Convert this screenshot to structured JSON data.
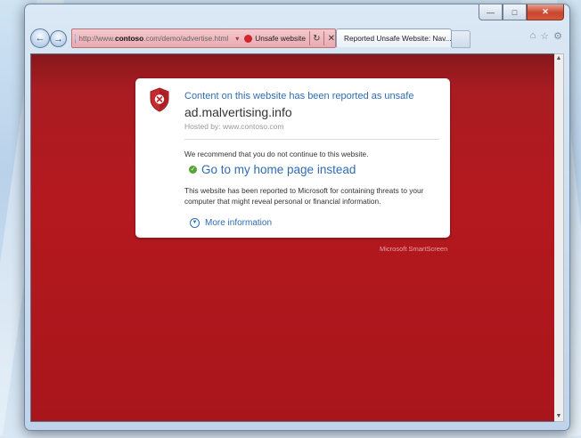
{
  "browser": {
    "address": {
      "url_prefix": "http://www.",
      "url_host": "contoso",
      "url_suffix": ".com/demo/advertise.html",
      "warning_label": "Unsafe website",
      "refresh_glyph": "↻",
      "stop_glyph": "✕"
    },
    "tab": {
      "title": "Reported Unsafe Website: Nav..."
    },
    "caption": {
      "minimize": "—",
      "maximize": "□",
      "close": "✕"
    },
    "nav": {
      "back_glyph": "←",
      "forward_glyph": "→"
    },
    "tools": {
      "home": "⌂",
      "favorites": "☆",
      "settings": "⚙"
    }
  },
  "warning_page": {
    "heading": "Content on this website has been reported as unsafe",
    "site": "ad.malvertising.info",
    "hosted_by": "Hosted by: www.contoso.com",
    "recommendation": "We recommend that you do not continue to this website.",
    "home_link": "Go to my home page instead",
    "description": "This website has been reported to Microsoft for containing threats to your computer that might reveal personal or financial information.",
    "more_info": "More information",
    "footer": "Microsoft SmartScreen"
  },
  "colors": {
    "page_background": "#a51d22",
    "link": "#2f6cb3",
    "address_warning": "#e9aab1"
  }
}
